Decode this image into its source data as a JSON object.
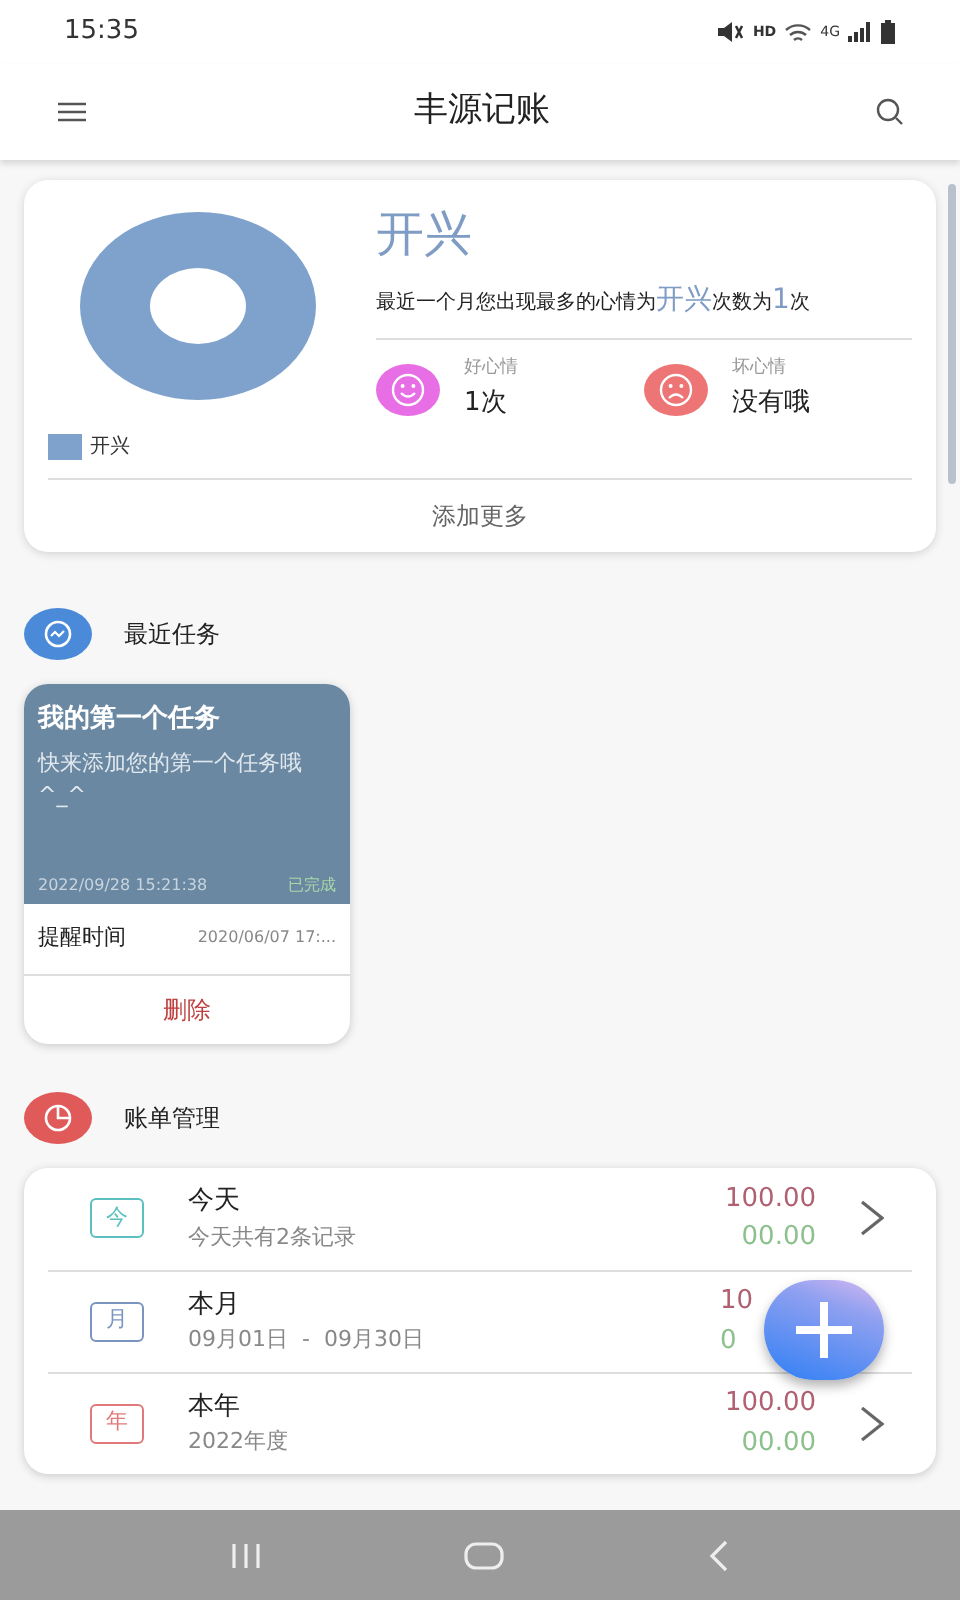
{
  "status_bar": {
    "time": "15:35",
    "network": "HD",
    "cellular": "4G"
  },
  "app_bar": {
    "title": "丰源记账"
  },
  "mood_card": {
    "legend": [
      {
        "label": "开兴",
        "color": "#7fa2cc"
      }
    ],
    "top_mood": "开兴",
    "summary": "最近一个月您出现最多的心情为**开兴**次数为**1**次",
    "stats": [
      {
        "kind": "good",
        "label": "好心情",
        "value": "1次"
      },
      {
        "kind": "bad",
        "label": "坏心情",
        "value": "没有哦"
      }
    ],
    "more_button": "添加更多"
  },
  "tasks_section": {
    "title": "最近任务",
    "tasks": [
      {
        "title": "我的第一个任务",
        "body": "快来添加您的第一个任务哦 ^_^",
        "created": "2022/09/28 15:21:38",
        "status": "已完成",
        "remind_label": "提醒时间",
        "remind_time": "2020/06/07 17:...",
        "delete": "删除"
      }
    ]
  },
  "bills_section": {
    "title": "账单管理",
    "rows": [
      {
        "kind": "day",
        "badge": "今",
        "title": "今天",
        "subtitle": "今天共有2条记录",
        "income": "100.00",
        "expense": "00.00",
        "covered": false
      },
      {
        "kind": "month",
        "badge": "月",
        "title": "本月",
        "subtitle": "09月01日  -  09月30日",
        "income": "10",
        "expense": "0",
        "covered": true
      },
      {
        "kind": "year",
        "badge": "年",
        "title": "本年",
        "subtitle": "2022年度",
        "income": "100.00",
        "expense": "00.00",
        "covered": false
      }
    ]
  }
}
